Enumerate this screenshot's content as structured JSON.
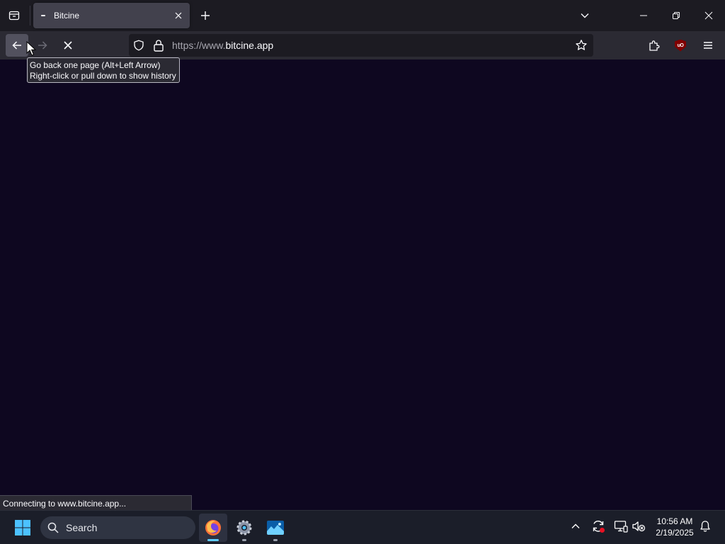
{
  "browser": {
    "tab": {
      "title": "Bitcine"
    },
    "urlbar": {
      "scheme_prefix": "https://www.",
      "domain": "bitcine.app"
    },
    "tooltip": {
      "line1": "Go back one page (Alt+Left Arrow)",
      "line2": "Right-click or pull down to show history"
    },
    "status": "Connecting to www.bitcine.app..."
  },
  "taskbar": {
    "search_label": "Search",
    "apps": [
      "firefox-icon",
      "settings-icon",
      "photos-icon"
    ],
    "clock": {
      "time": "10:56 AM",
      "date": "2/19/2025"
    }
  },
  "colors": {
    "content_bg": "#0e0720",
    "toolbar_bg": "#2b2a33",
    "tabstrip_bg": "#1c1b22",
    "taskbar_bg": "#1b1e29",
    "accent": "#0078d4"
  }
}
